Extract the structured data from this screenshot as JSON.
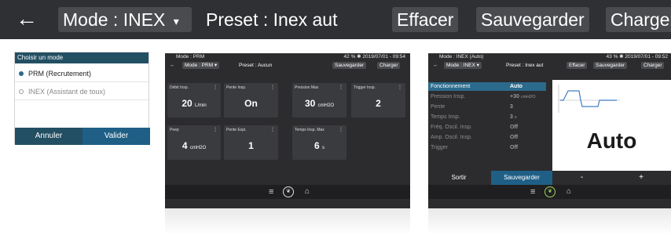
{
  "topbar": {
    "mode_label": "Mode : INEX",
    "preset_label": "Preset : Inex aut",
    "effacer_label": "Effacer",
    "sauvegarder_label": "Sauvegarder",
    "charger_label": "Charger"
  },
  "dialog": {
    "title": "Choisir un mode",
    "options": [
      {
        "label": "PRM (Recrutement)",
        "selected": true
      },
      {
        "label": "INEX (Assistant de toux)",
        "selected": false
      }
    ],
    "cancel_label": "Annuler",
    "confirm_label": "Valider"
  },
  "screen_prm": {
    "mode_text": "Mode : PRM",
    "status_text": "42 % ✱ 2019/07/01 - 09:54",
    "mode_chip": "Mode : PRM",
    "preset": "Preset : Aucun",
    "sauvegarder": "Sauvegarder",
    "charger": "Charger",
    "cards": [
      {
        "title": "Débit Insp.",
        "value": "20",
        "unit": "L/min"
      },
      {
        "title": "Pente Insp.",
        "value": "On",
        "unit": ""
      },
      {
        "title": "Pression Max",
        "value": "30",
        "unit": "cmH2O"
      },
      {
        "title": "Trigger Insp.",
        "value": "2",
        "unit": ""
      },
      {
        "title": "Peep",
        "value": "4",
        "unit": "cmH2O"
      },
      {
        "title": "Pente Expi.",
        "value": "1",
        "unit": ""
      },
      {
        "title": "Temps Insp. Max",
        "value": "6",
        "unit": "s"
      }
    ]
  },
  "screen_inex": {
    "mode_text": "Mode : INEX (Auto)",
    "status_text": "43 % ✱ 2019/07/01 - 09:52",
    "mode_chip": "Mode : INEX",
    "preset": "Preset : Inex aut",
    "effacer": "Effacer",
    "sauvegarder": "Sauvegarder",
    "charger": "Charger",
    "params": [
      {
        "label": "Fonctionnement",
        "value": "Auto",
        "unit": ""
      },
      {
        "label": "Pression Insp.",
        "value": "+30",
        "unit": "cmH2O"
      },
      {
        "label": "Pente",
        "value": "3",
        "unit": ""
      },
      {
        "label": "Temps Insp.",
        "value": "3",
        "unit": "s"
      },
      {
        "label": "Fréq. Oscil. Insp.",
        "value": "Off",
        "unit": ""
      },
      {
        "label": "Amp. Oscil. Insp.",
        "value": "Off",
        "unit": ""
      },
      {
        "label": "Trigger",
        "value": "Off",
        "unit": ""
      }
    ],
    "big_value": "Auto",
    "sortir": "Sortir",
    "save": "Sauvegarder",
    "minus": "-",
    "plus": "+"
  },
  "colors": {
    "dialog_blue": "#234f63",
    "selected_row": "#2c6a8c",
    "save_blue": "#1f5f86",
    "topbar": "#2f3033"
  },
  "icons": [
    "back-arrow-icon",
    "chevron-down-icon",
    "battery-icon",
    "bluetooth-icon",
    "menu-icon",
    "home-icon",
    "lungs-icon"
  ]
}
